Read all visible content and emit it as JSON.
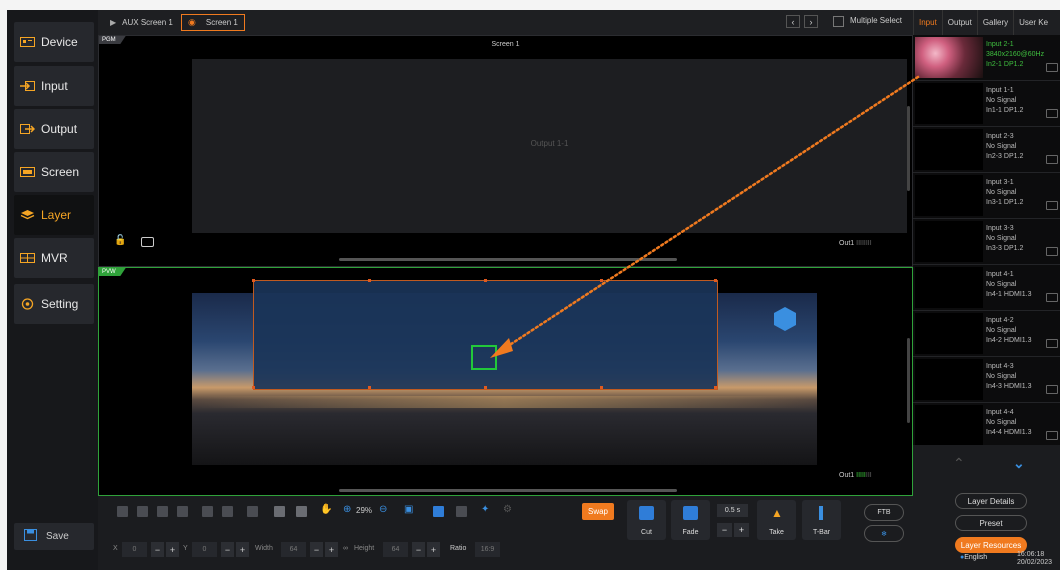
{
  "sidebar": {
    "items": [
      {
        "label": "Device",
        "icon": "device-icon"
      },
      {
        "label": "Input",
        "icon": "input-icon"
      },
      {
        "label": "Output",
        "icon": "output-icon"
      },
      {
        "label": "Screen",
        "icon": "screen-icon"
      },
      {
        "label": "Layer",
        "icon": "layer-icon",
        "active": true
      },
      {
        "label": "MVR",
        "icon": "mvr-icon"
      },
      {
        "label": "Setting",
        "icon": "setting-icon"
      }
    ],
    "save_label": "Save"
  },
  "topbar": {
    "aux_label": "AUX Screen 1",
    "screen_label": "Screen 1",
    "multiple_select": "Multiple Select"
  },
  "right_tabs": [
    "Input",
    "Output",
    "Gallery",
    "User Ke"
  ],
  "sources": [
    {
      "name": "Input 2-1",
      "status": "3840x2160@60Hz",
      "port": "In2-1  DP1.2",
      "active": true
    },
    {
      "name": "Input 1-1",
      "status": "No Signal",
      "port": "In1-1  DP1.2"
    },
    {
      "name": "Input 2-3",
      "status": "No Signal",
      "port": "In2-3  DP1.2"
    },
    {
      "name": "Input 3-1",
      "status": "No Signal",
      "port": "In3-1  DP1.2"
    },
    {
      "name": "Input 3-3",
      "status": "No Signal",
      "port": "In3-3  DP1.2"
    },
    {
      "name": "Input 4-1",
      "status": "No Signal",
      "port": "In4-1  HDMI1.3"
    },
    {
      "name": "Input 4-2",
      "status": "No Signal",
      "port": "In4-2  HDMI1.3"
    },
    {
      "name": "Input 4-3",
      "status": "No Signal",
      "port": "In4-3  HDMI1.3"
    },
    {
      "name": "Input 4-4",
      "status": "No Signal",
      "port": "In4-4  HDMI1.3"
    }
  ],
  "right_bottom": {
    "layer_details": "Layer Details",
    "preset": "Preset",
    "layer_resources": "Layer Resources",
    "language": "English",
    "time": "16:06:18",
    "date": "20/02/2023"
  },
  "pgm": {
    "tag": "PGM",
    "title": "Screen 1",
    "output_label": "Output 1-1",
    "out_badge": "Out1",
    "bars": "IIIIIIII"
  },
  "pvw": {
    "tag": "PVW",
    "out_badge": "Out1",
    "bars_live": "IIIII",
    "bars_dim": "III"
  },
  "toolbar": {
    "zoom": "29%",
    "swap": "Swap",
    "cut": "Cut",
    "fade": "Fade",
    "duration": "0.5 s",
    "minus": "−",
    "plus": "+",
    "take": "Take",
    "tbar": "T-Bar",
    "ftb": "FTB",
    "x_label": "X",
    "x_value": "0",
    "y_label": "Y",
    "y_value": "0",
    "width_label": "Width",
    "width_value": "64",
    "height_label": "Height",
    "height_value": "64",
    "ratio_label": "Ratio",
    "ratio_value": "16:9"
  },
  "colors": {
    "accent": "#f07a1f",
    "pvw_green": "#2fa23a",
    "active_source": "#3fbf3f"
  }
}
